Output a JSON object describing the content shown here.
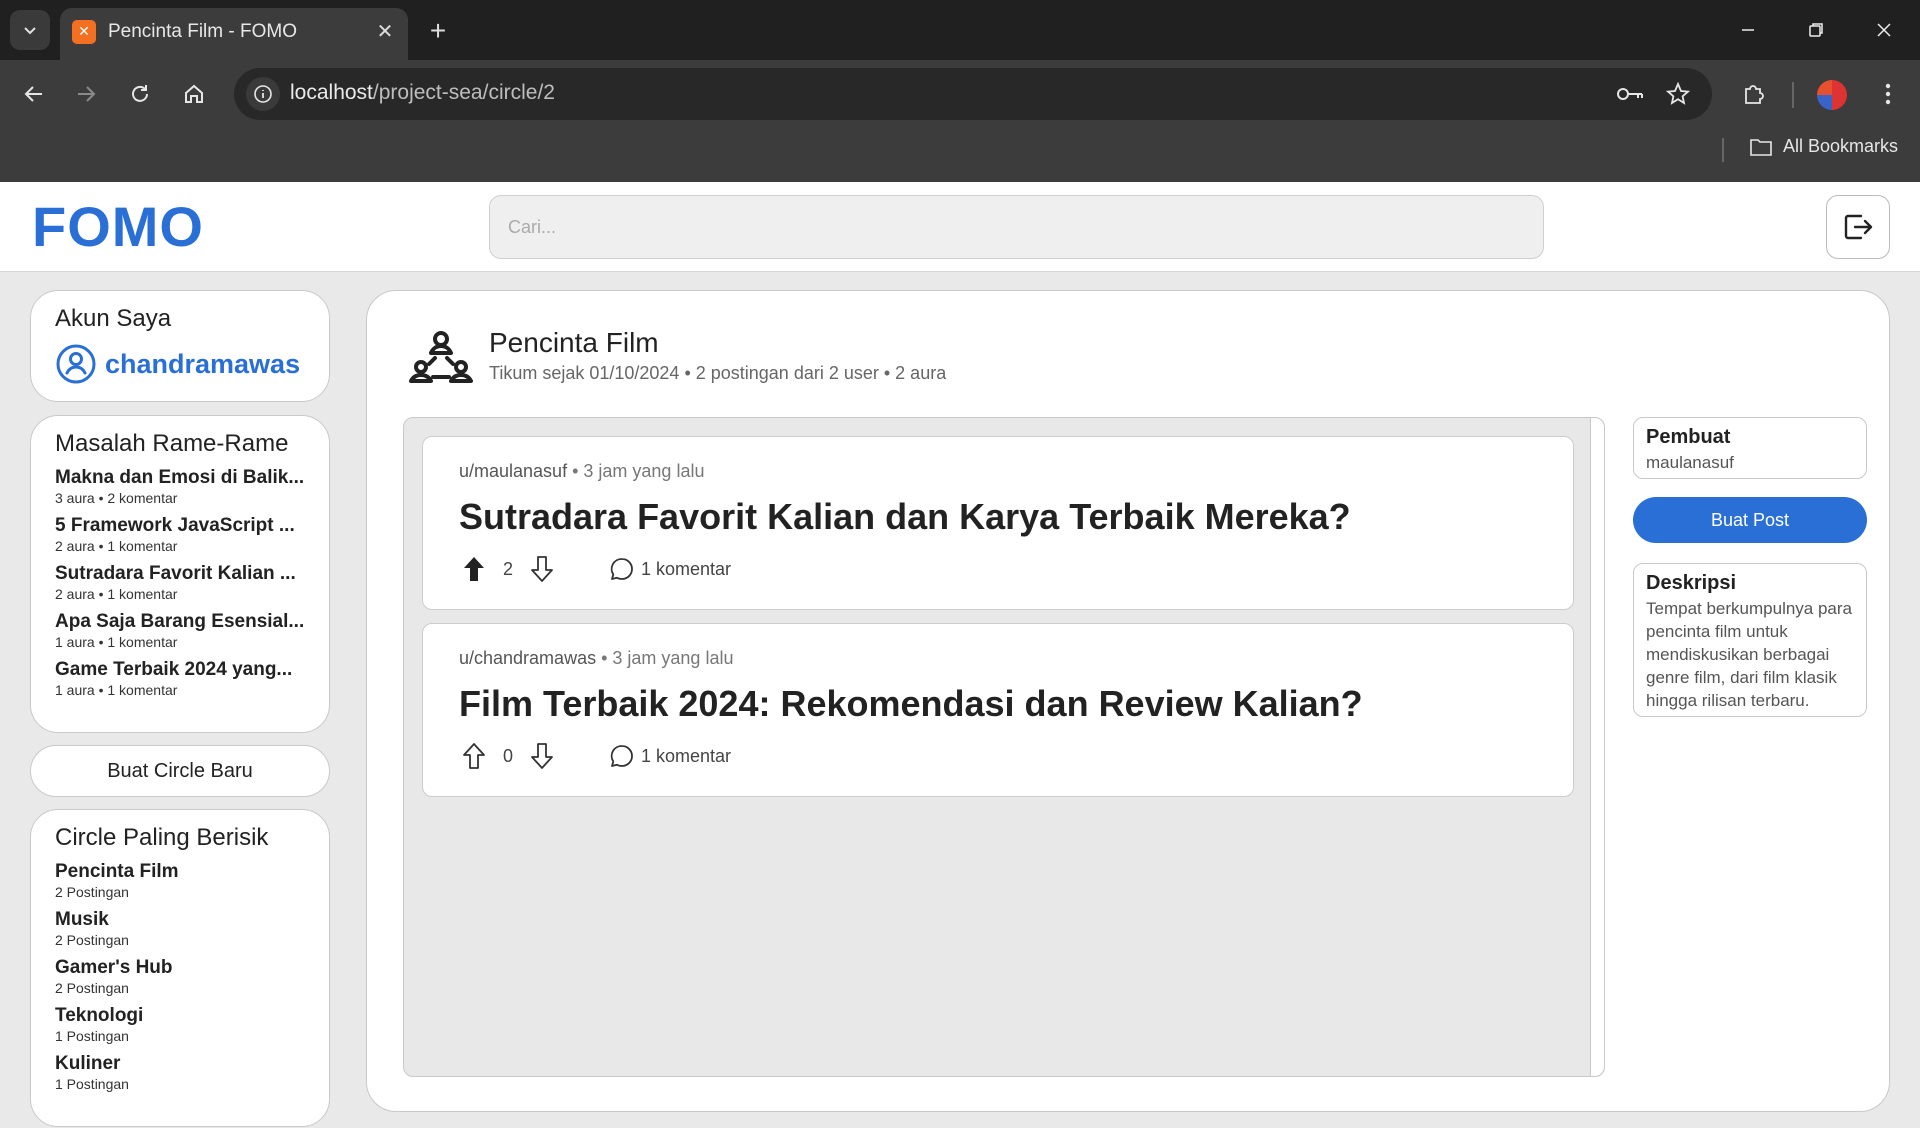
{
  "browser": {
    "tab_title": "Pencinta Film - FOMO",
    "url_host": "localhost",
    "url_path": "/project-sea/circle/2",
    "bookmarks_label": "All Bookmarks"
  },
  "header": {
    "logo": "FOMO",
    "search_placeholder": "Cari..."
  },
  "account": {
    "heading": "Akun Saya",
    "username": "chandramawas"
  },
  "trending": {
    "heading": "Masalah Rame-Rame",
    "items": [
      {
        "title": "Makna dan Emosi di Balik...",
        "meta": "3 aura • 2 komentar"
      },
      {
        "title": "5 Framework JavaScript ...",
        "meta": "2 aura • 1 komentar"
      },
      {
        "title": "Sutradara Favorit Kalian ...",
        "meta": "2 aura • 1 komentar"
      },
      {
        "title": "Apa Saja Barang Esensial...",
        "meta": "1 aura • 1 komentar"
      },
      {
        "title": "Game Terbaik 2024 yang...",
        "meta": "1 aura • 1 komentar"
      }
    ]
  },
  "new_circle_label": "Buat Circle Baru",
  "noisy": {
    "heading": "Circle Paling Berisik",
    "items": [
      {
        "name": "Pencinta Film",
        "meta": "2 Postingan"
      },
      {
        "name": "Musik",
        "meta": "2 Postingan"
      },
      {
        "name": "Gamer's Hub",
        "meta": "2 Postingan"
      },
      {
        "name": "Teknologi",
        "meta": "1 Postingan"
      },
      {
        "name": "Kuliner",
        "meta": "1 Postingan"
      }
    ]
  },
  "circle": {
    "name": "Pencinta Film",
    "meta": "Tikum sejak 01/10/2024 • 2 postingan dari 2 user • 2 aura"
  },
  "posts": [
    {
      "author": "u/maulanasuf",
      "time": "• 3 jam yang lalu",
      "title": "Sutradara Favorit Kalian dan Karya Terbaik Mereka?",
      "votes": "2",
      "upvoted": true,
      "comments": "1 komentar"
    },
    {
      "author": "u/chandramawas",
      "time": "• 3 jam yang lalu",
      "title": "Film Terbaik 2024: Rekomendasi dan Review Kalian?",
      "votes": "0",
      "upvoted": false,
      "comments": "1 komentar"
    }
  ],
  "sidebar_right": {
    "creator_label": "Pembuat",
    "creator_name": "maulanasuf",
    "create_post_label": "Buat Post",
    "description_label": "Deskripsi",
    "description": "Tempat berkumpulnya para pencinta film untuk mendiskusikan berbagai genre film, dari film klasik hingga rilisan terbaru."
  }
}
